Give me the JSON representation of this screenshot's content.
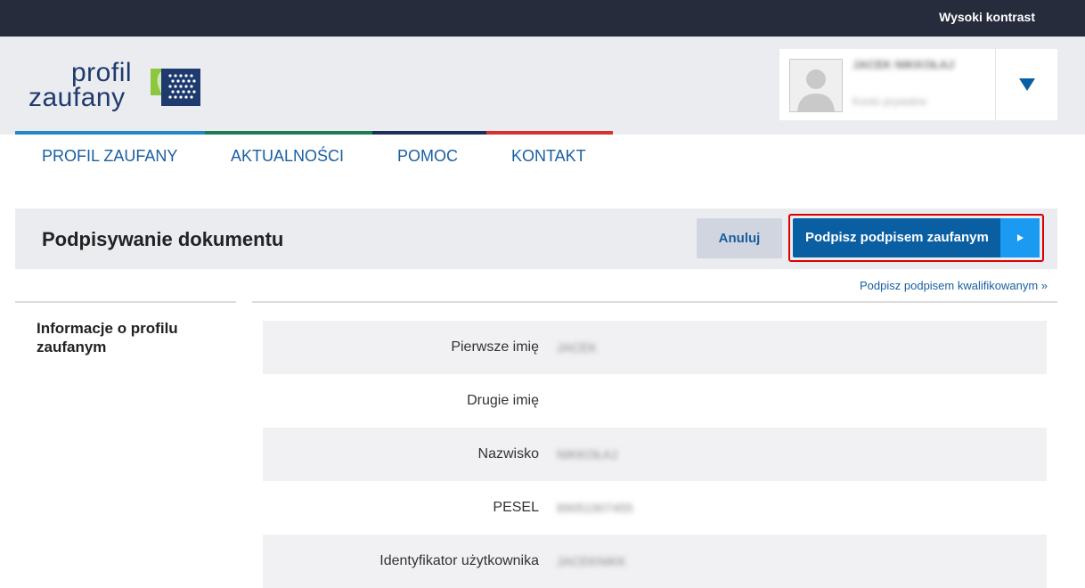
{
  "topbar": {
    "contrast_label": "Wysoki kontrast"
  },
  "logo": {
    "line1": "profil",
    "line2": "zaufany"
  },
  "user": {
    "name": "JACEK NIKKOŁAJ",
    "role": "Konto prywatne"
  },
  "nav": {
    "items": [
      {
        "label": "PROFIL ZAUFANY"
      },
      {
        "label": "AKTUALNOŚCI"
      },
      {
        "label": "POMOC"
      },
      {
        "label": "KONTAKT"
      }
    ]
  },
  "stripe_colors": [
    "#1f86c8",
    "#1c7c54",
    "#1e2e5c",
    "#d3322e"
  ],
  "page": {
    "title": "Podpisywanie dokumentu",
    "cancel_label": "Anuluj",
    "sign_label": "Podpisz podpisem zaufanym",
    "qualified_link": "Podpisz podpisem kwalifikowanym »"
  },
  "sidebar": {
    "heading": "Informacje o profilu zaufanym"
  },
  "info_rows": [
    {
      "label": "Pierwsze imię",
      "value": "JACEK"
    },
    {
      "label": "Drugie imię",
      "value": ""
    },
    {
      "label": "Nazwisko",
      "value": "NIKKOŁAJ"
    },
    {
      "label": "PESEL",
      "value": "89051907455"
    },
    {
      "label": "Identyfikator użytkownika",
      "value": "JACEKNIKK"
    }
  ],
  "colors": {
    "accent": "#0a5fa3",
    "accent_light": "#1a9af0",
    "focus_border": "#dd0000",
    "topbar": "#262c3c"
  }
}
